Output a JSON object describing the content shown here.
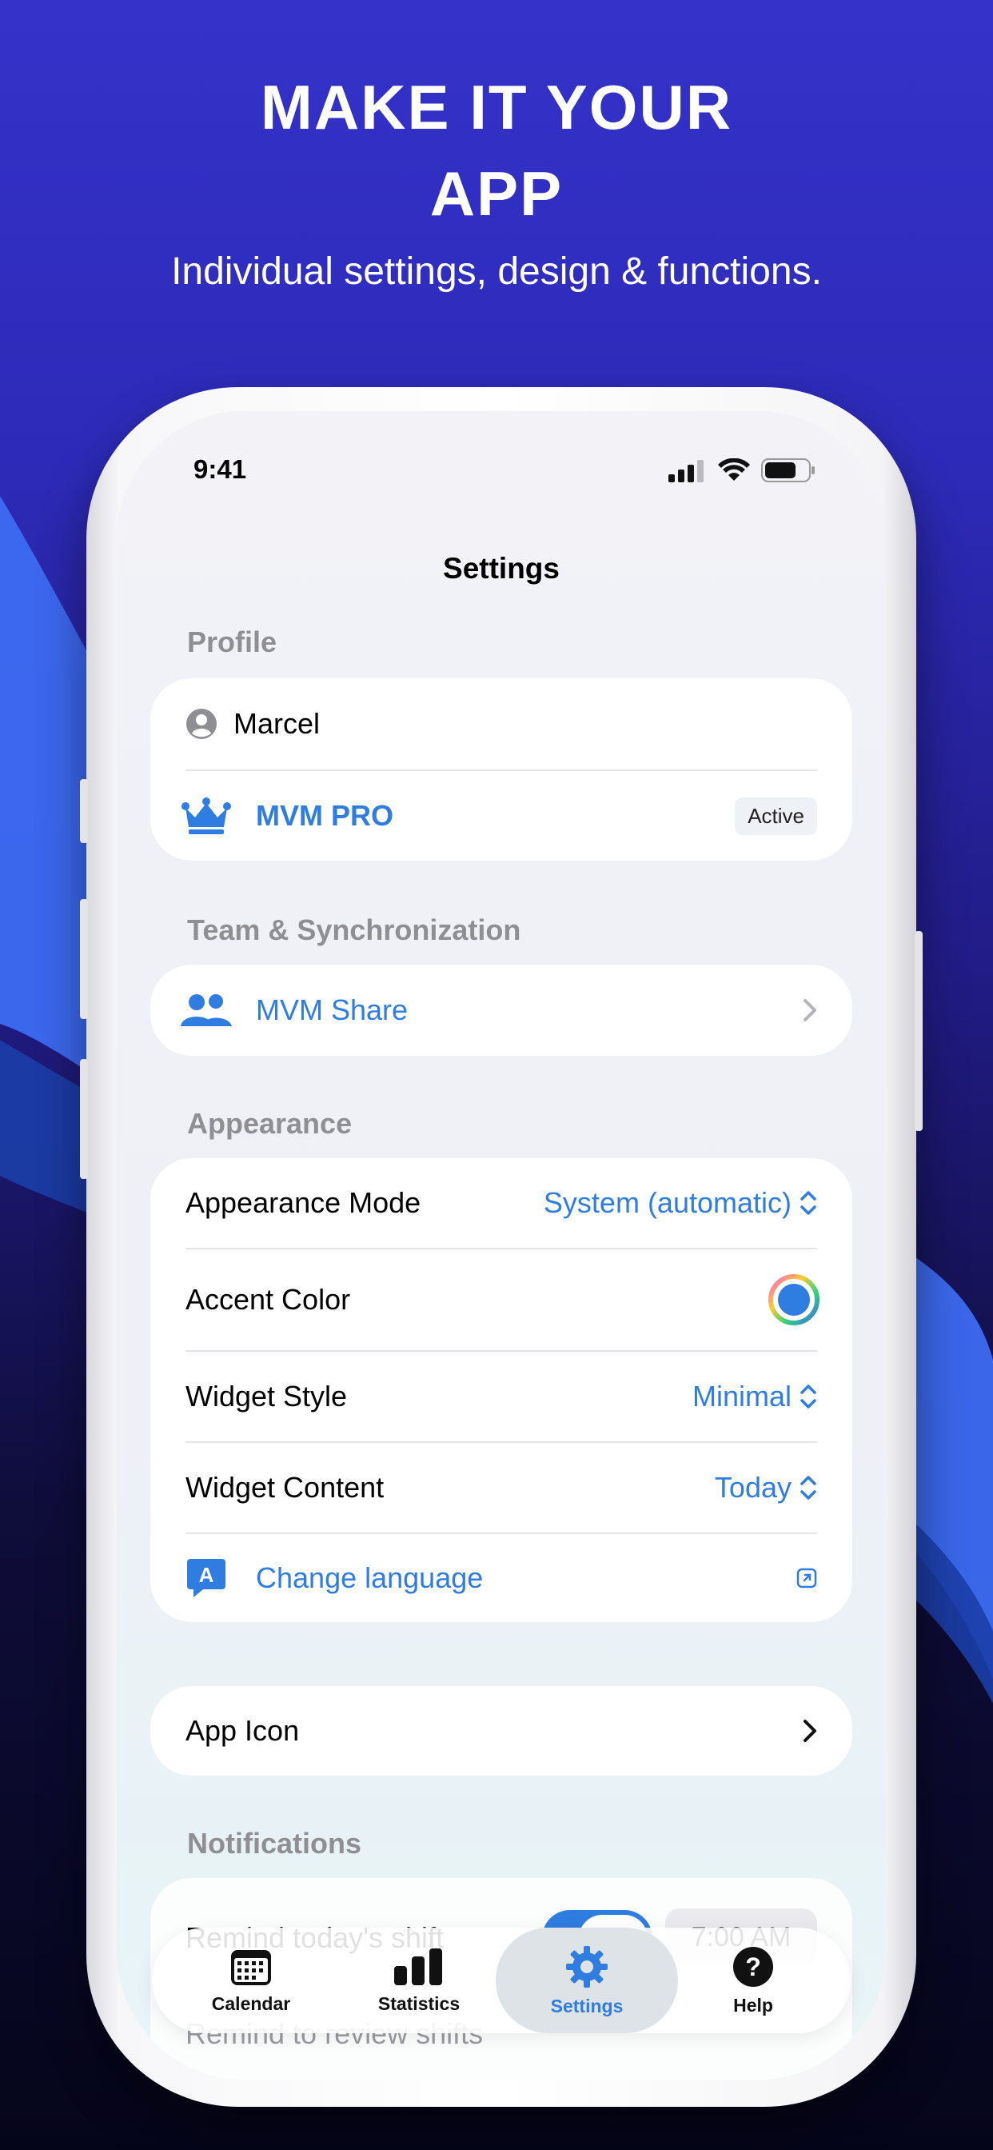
{
  "hero": {
    "title_line1": "MAKE IT YOUR",
    "title_line2": "APP",
    "subtitle": "Individual settings, design & functions."
  },
  "status_bar": {
    "time": "9:41"
  },
  "nav": {
    "title": "Settings"
  },
  "profile": {
    "section": "Profile",
    "user_name": "Marcel",
    "pro_label": "MVM PRO",
    "pro_status": "Active"
  },
  "team": {
    "section": "Team & Synchronization",
    "share_label": "MVM Share"
  },
  "appearance": {
    "section": "Appearance",
    "mode_label": "Appearance Mode",
    "mode_value": "System (automatic)",
    "accent_label": "Accent Color",
    "widget_style_label": "Widget Style",
    "widget_style_value": "Minimal",
    "widget_content_label": "Widget Content",
    "widget_content_value": "Today",
    "language_label": "Change language"
  },
  "app_icon": {
    "label": "App Icon"
  },
  "notifications": {
    "section": "Notifications",
    "remind_today": "Remind today's shift",
    "remind_time": "7:00 AM",
    "remind_review": "Remind to review shifts"
  },
  "tabs": [
    {
      "label": "Calendar",
      "icon": "calendar-icon"
    },
    {
      "label": "Statistics",
      "icon": "bar-chart-icon"
    },
    {
      "label": "Settings",
      "icon": "gear-icon"
    },
    {
      "label": "Help",
      "icon": "question-icon"
    }
  ],
  "colors": {
    "accent": "#2f7de0",
    "background_top": "#3432c9",
    "background_bottom": "#05051a"
  }
}
